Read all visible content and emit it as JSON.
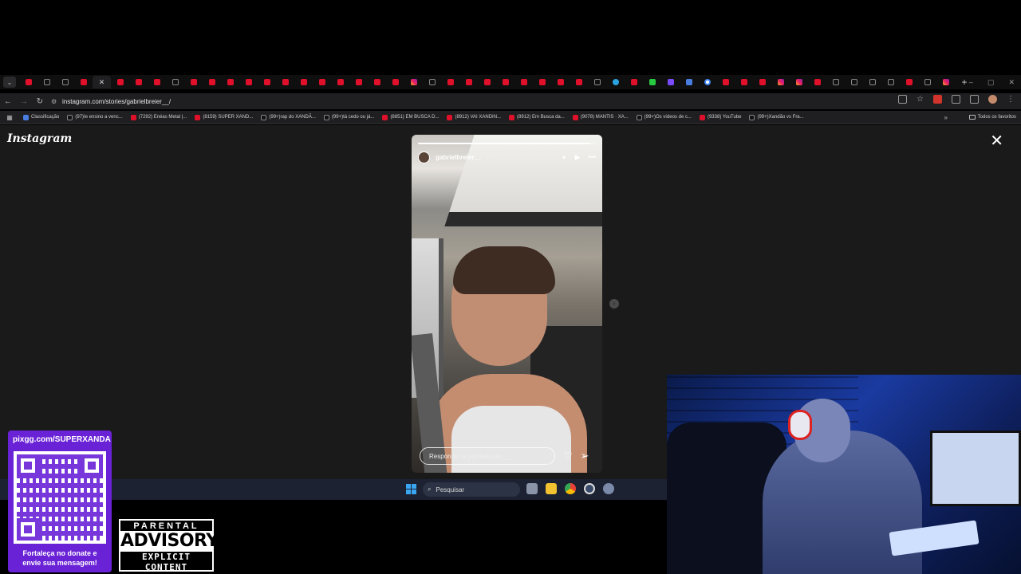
{
  "browser": {
    "tabs": [
      "yt",
      "tt",
      "tt",
      "yt",
      "x",
      "yt",
      "yt",
      "yt",
      "tt",
      "yt",
      "yt",
      "yt",
      "yt",
      "yt",
      "yt",
      "yt",
      "yt",
      "yt",
      "yt",
      "yt",
      "yt",
      "ig",
      "tt",
      "yt",
      "yt",
      "yt",
      "yt",
      "yt",
      "yt",
      "yt",
      "yt",
      "tt",
      "tg",
      "yt",
      "kk",
      "tw",
      "doc",
      "gg",
      "yt",
      "yt",
      "yt",
      "ig",
      "ig",
      "yt",
      "tt",
      "tt",
      "tt",
      "tt",
      "yt",
      "tt",
      "ig"
    ],
    "new_tab": "+",
    "window_controls": [
      "–",
      "▢",
      "✕"
    ],
    "url": "instagram.com/stories/gabrielbreier__/",
    "bookmarks": [
      {
        "icon": "doc",
        "label": "Classificação"
      },
      {
        "icon": "tt",
        "label": "(97)Ie ensino a venc..."
      },
      {
        "icon": "yt",
        "label": "(7292) Enéas Metal |..."
      },
      {
        "icon": "yt",
        "label": "(8159) SUPER XAND..."
      },
      {
        "icon": "tt",
        "label": "(99+)rap do XANDÃ..."
      },
      {
        "icon": "tt",
        "label": "(99+)tá cedo ou já..."
      },
      {
        "icon": "yt",
        "label": "(8851) EM BUSCA D..."
      },
      {
        "icon": "yt",
        "label": "(8912) VAI XANDIN..."
      },
      {
        "icon": "yt",
        "label": "(8912) Em Busca da..."
      },
      {
        "icon": "yt",
        "label": "(9078) MANTIS · XA..."
      },
      {
        "icon": "tt",
        "label": "(99+)Os vídeos de c..."
      },
      {
        "icon": "yt",
        "label": "(9338) YouTube"
      },
      {
        "icon": "tt",
        "label": "(99+)Xandão vs Fra..."
      }
    ],
    "bookmarks_more": "»",
    "all_bookmarks": "Todos os favoritos"
  },
  "instagram": {
    "logo": "Instagram",
    "close": "✕",
    "next": "›",
    "story": {
      "username": "gabrielbreier__",
      "time": "2 h",
      "progress": 0.97,
      "reply_placeholder": "Responder a gabrielbreier__...",
      "icons": [
        "mute-icon",
        "play-icon",
        "more-icon",
        "heart-icon",
        "send-icon"
      ]
    }
  },
  "taskbar": {
    "search": "Pesquisar",
    "apps": [
      "task-view",
      "file-explorer",
      "chrome",
      "steam",
      "settings"
    ]
  },
  "overlay": {
    "qr_url": "pixgg.com/SUPERXANDA",
    "qr_caption_1": "Fortaleça no donate e",
    "qr_caption_2": "envie sua mensagem!",
    "advisory_top": "PARENTAL",
    "advisory_mid": "ADVISORY",
    "advisory_bottom": "EXPLICIT CONTENT"
  },
  "colors": {
    "qr_purple": "#6a22d6",
    "youtube_red": "#e0102a",
    "taskbar": "#1c2232",
    "page_bg": "#1a1a1a"
  }
}
